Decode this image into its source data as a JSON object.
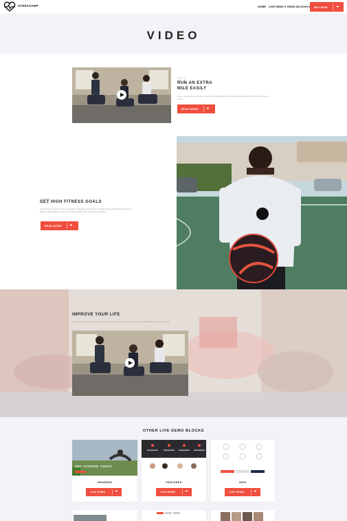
{
  "brand": {
    "name": "STRESSAMP"
  },
  "nav": {
    "home": "HOME",
    "live_demo": "LIVE DEMO",
    "demo_blocks": "DEMO BLOCKS",
    "buy_now": "BUY NOW"
  },
  "page": {
    "title": "VIDEO"
  },
  "sections": [
    {
      "number": "01",
      "heading_line1": "RUN AN EXTRA",
      "heading_line2": "MILE EASILY",
      "text": "Lorem ipsum dolor sit amet, consectetur adipiscing elit sed do eiusmod tempor incididunt ut labore et dolore.",
      "button": "READ MORE"
    },
    {
      "number": "02",
      "heading": "GET HIGH FITNESS GOALS",
      "text": "Lorem ipsum dolor sit amet, consectetur adipiscing elit sed do eiusmod tempor incididunt ut labore et dolore magna aliqua. Ut enim ad minim veniam quis nostrud exercitation.",
      "button": "READ MORE"
    },
    {
      "heading": "IMPROVE YOUR LIFE",
      "text": "Lorem ipsum dolor sit amet consectetur adipiscing elit sed do eiusmod tempor incididunt ut labore et dolore."
    }
  ],
  "other": {
    "title": "OTHER LIVE DEMO BLOCKS",
    "cards": [
      {
        "image_text": "GET STRONG TODAY",
        "caption": "HEADERS",
        "button": "LIVE DEMO"
      },
      {
        "caption": "FEATURES",
        "button": "LIVE DEMO"
      },
      {
        "caption": "INFO",
        "button": "LIVE DEMO"
      }
    ]
  },
  "colors": {
    "accent": "#f04e3e",
    "band": "#f3f2f6"
  },
  "icons": [
    "heart-pulse-logo-icon",
    "chevron-down-icon",
    "arrow-right-icon",
    "play-icon"
  ]
}
